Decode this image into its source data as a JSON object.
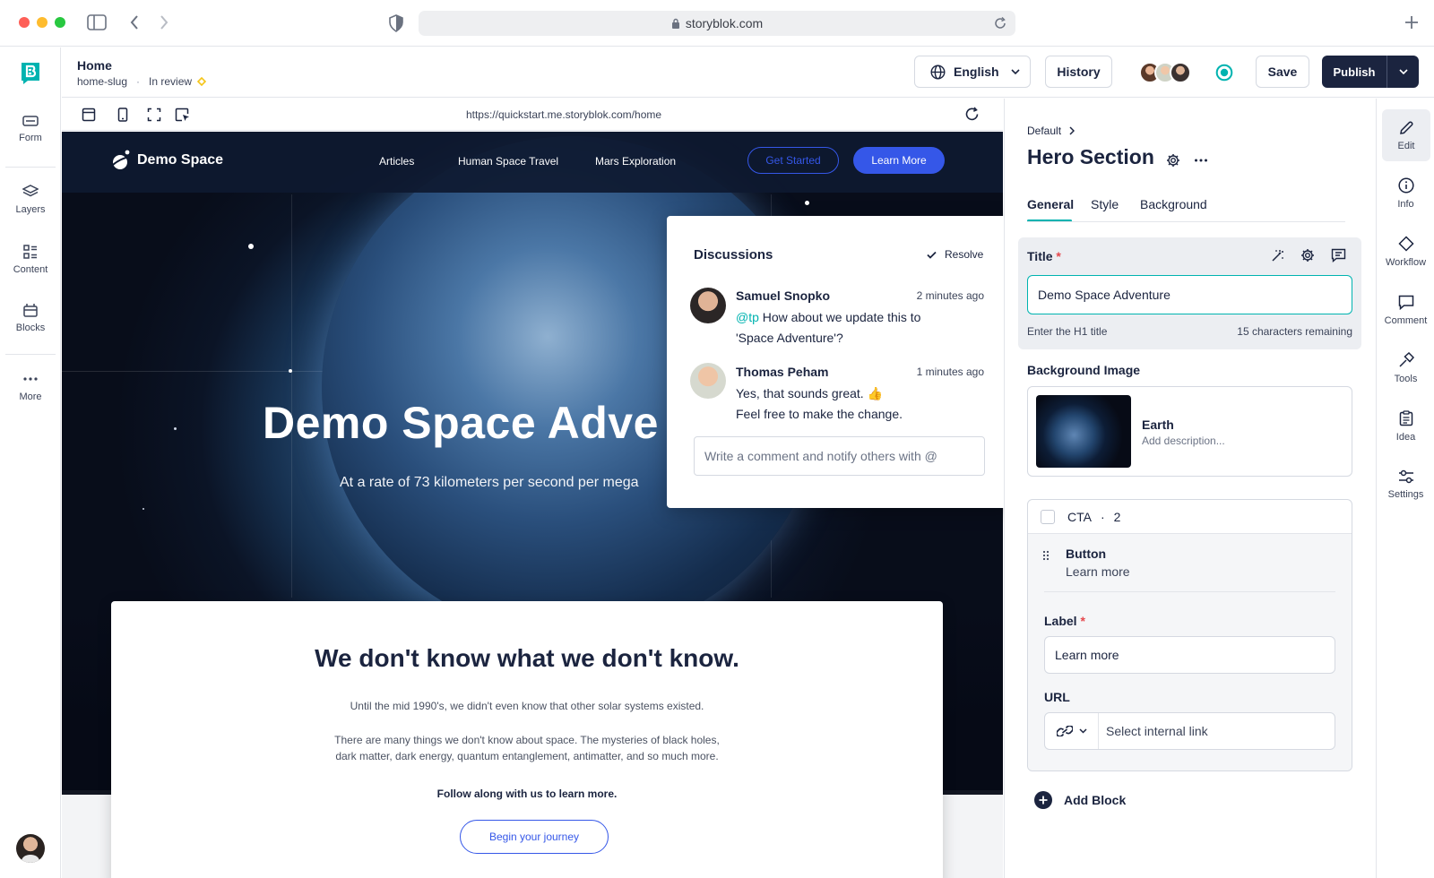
{
  "browser": {
    "url": "storyblok.com"
  },
  "sidebar": {
    "items": [
      {
        "label": "Form",
        "icon": "form-icon"
      },
      {
        "label": "Layers",
        "icon": "layers-icon"
      },
      {
        "label": "Content",
        "icon": "content-icon"
      },
      {
        "label": "Blocks",
        "icon": "blocks-icon"
      },
      {
        "label": "More",
        "icon": "more-icon"
      }
    ]
  },
  "header": {
    "story_name": "Home",
    "slug": "home-slug",
    "separator": "·",
    "status": "In review",
    "status_color": "#f5c518",
    "language": "English",
    "history": "History",
    "save": "Save",
    "publish": "Publish"
  },
  "preview_toolbar": {
    "url": "https://quickstart.me.storyblok.com/home"
  },
  "site": {
    "logo": "Demo Space",
    "nav": [
      "Articles",
      "Human Space Travel",
      "Mars Exploration"
    ],
    "get_started": "Get Started",
    "learn_more": "Learn More",
    "hero_title": "Demo Space Adve",
    "hero_subtitle": "At a rate of 73 kilometers per second per mega",
    "card_title": "We don't know what we don't know.",
    "card_p1": "Until the mid 1990's, we didn't even know that other solar systems existed.",
    "card_p2a": "There are many things we don't know about space. The mysteries of black holes,",
    "card_p2b": "dark matter, dark energy, quantum entanglement, antimatter, and so much more.",
    "card_p3": "Follow along with us to learn more.",
    "card_button": "Begin your journey"
  },
  "discussions": {
    "title": "Discussions",
    "resolve": "Resolve",
    "comments": [
      {
        "author": "Samuel Snopko",
        "time": "2 minutes ago",
        "mention": "@tp",
        "line1": " How about we update this to",
        "line2": "'Space Adventure'?"
      },
      {
        "author": "Thomas Peham",
        "time": "1 minutes ago",
        "line1": "Yes, that sounds great. 👍",
        "line2": "Feel free to make the change."
      }
    ],
    "placeholder": "Write a comment and notify others with @"
  },
  "panel": {
    "breadcrumb": "Default",
    "title": "Hero Section",
    "tabs": [
      "General",
      "Style",
      "Background"
    ],
    "title_field": {
      "label": "Title",
      "required": "*",
      "value": "Demo Space Adventure",
      "help": "Enter the H1 title",
      "remaining": "15 characters remaining"
    },
    "bg_image": {
      "label": "Background Image",
      "name": "Earth",
      "description": "Add description..."
    },
    "cta": {
      "label": "CTA",
      "separator": "·",
      "count": "2"
    },
    "button_block": {
      "name": "Button",
      "value": "Learn more"
    },
    "label_field": {
      "label": "Label",
      "required": "*",
      "value": "Learn more"
    },
    "url_field": {
      "label": "URL",
      "placeholder": "Select internal link"
    },
    "add_block": "Add Block"
  },
  "right_bar": {
    "items": [
      {
        "label": "Edit",
        "icon": "pencil-icon"
      },
      {
        "label": "Info",
        "icon": "info-icon"
      },
      {
        "label": "Workflow",
        "icon": "workflow-icon"
      },
      {
        "label": "Comment",
        "icon": "comment-icon"
      },
      {
        "label": "Tools",
        "icon": "tools-icon"
      },
      {
        "label": "Idea",
        "icon": "idea-icon"
      },
      {
        "label": "Settings",
        "icon": "settings-sliders-icon"
      }
    ]
  },
  "colors": {
    "brand_teal": "#00b3b0",
    "primary_blue": "#3557e8",
    "publish": "#1b243f",
    "required": "#e5484d"
  }
}
